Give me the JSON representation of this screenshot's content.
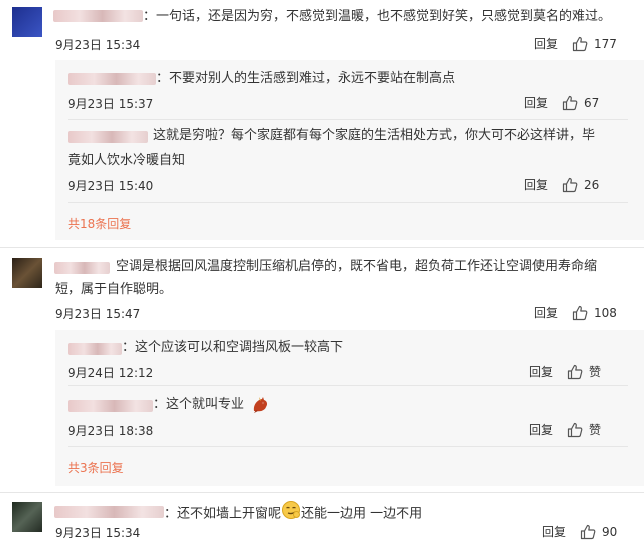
{
  "comments": [
    {
      "text": "：一句话，还是因为穷，不感觉到温暖，也不感觉到好笑，只感觉到莫名的难过。",
      "time": "9月23日 15:34",
      "reply_label": "回复",
      "likes": "177",
      "replies": [
        {
          "text": "：不要对别人的生活感到难过，永远不要站在制高点",
          "time": "9月23日 15:37",
          "reply_label": "回复",
          "likes": "67"
        },
        {
          "text_line1": "这就是穷啦？每个家庭都有每个家庭的生活相处方式，你大可不必这样讲，毕",
          "text_line2": "竟如人饮水冷暖自知",
          "time": "9月23日 15:40",
          "reply_label": "回复",
          "likes": "26"
        }
      ],
      "more_label": "共18条回复"
    },
    {
      "text_line1": "空调是根据回风温度控制压缩机启停的，既不省电，超负荷工作还让空调使用寿命缩",
      "text_line2": "短，属于自作聪明。",
      "time": "9月23日 15:47",
      "reply_label": "回复",
      "likes": "108",
      "replies": [
        {
          "text": "：这个应该可以和空调挡风板一较高下",
          "time": "9月24日 12:12",
          "reply_label": "回复",
          "likes": "赞"
        },
        {
          "text": "：这个就叫专业",
          "time": "9月23日 18:38",
          "reply_label": "回复",
          "likes": "赞"
        }
      ],
      "more_label": "共3条回复"
    },
    {
      "text_before": "：还不如墙上开窗呢",
      "text_after": "还能一边用 一边不用",
      "time": "9月23日 15:34",
      "reply_label": "回复",
      "likes": "90"
    }
  ],
  "icons": [
    "thumbs-up-icon",
    "smirk-emoji-icon",
    "dragon-emoji-icon"
  ],
  "colors": {
    "more_link": "#eb7350",
    "sub_background": "#f7f7f7",
    "divider": "#e6e6e6"
  }
}
